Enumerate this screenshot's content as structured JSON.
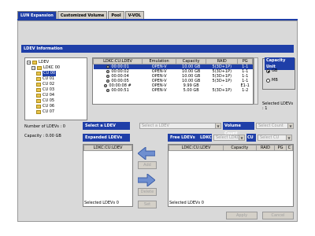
{
  "tabs": [
    "LUN Expansion",
    "Customized Volume",
    "Pool",
    "V-VOL"
  ],
  "ldev_info": {
    "title": "LDEV Information"
  },
  "tree": [
    {
      "label": "LDEV",
      "level": 0
    },
    {
      "label": "LDKC 00",
      "level": 1
    },
    {
      "label": "CU 00",
      "level": 2,
      "selected": true
    },
    {
      "label": "CU 01",
      "level": 2
    },
    {
      "label": "CU 02",
      "level": 2
    },
    {
      "label": "CU 03",
      "level": 2
    },
    {
      "label": "CU 04",
      "level": 2
    },
    {
      "label": "CU 05",
      "level": 2
    },
    {
      "label": "CU 06",
      "level": 2
    },
    {
      "label": "CU 07",
      "level": 2
    }
  ],
  "ldev_table": {
    "headers": [
      "LDKC:CU:LDEV",
      "Emulation",
      "Capacity",
      "RAID",
      "PG"
    ],
    "rows": [
      [
        "00:00:01",
        "OPEN-V",
        "10.00 GB",
        "5(3D+1P)",
        "1-1"
      ],
      [
        "00:00:02",
        "OPEN-V",
        "10.00 GB",
        "5(3D+1P)",
        "1-1"
      ],
      [
        "00:00:04",
        "OPEN-V",
        "10.00 GB",
        "5(3D+1P)",
        "1-1"
      ],
      [
        "00:00:05",
        "OPEN-V",
        "10.00 GB",
        "5(3D+1P)",
        "1-1"
      ],
      [
        "00:00:08 #",
        "OPEN-V",
        "9.99 GB",
        "-",
        "E1-1"
      ],
      [
        "00:00:51",
        "OPEN-V",
        "5.00 GB",
        "5(3D+1P)",
        "1-2"
      ]
    ]
  },
  "capacity_unit": {
    "title": "Capacity Unit",
    "options": [
      "GB",
      "MB"
    ],
    "selected_label": "Selected LDEVs :",
    "selected_value": "1"
  },
  "stats": {
    "num_label": "Number of LDEVs :",
    "num_value": "0",
    "cap_label": "Capacity :",
    "cap_value": "0.00 GB"
  },
  "select_ldev": {
    "label": "Select a LDEV",
    "placeholder": "Select a LDEV"
  },
  "volume_count": {
    "label": "Volume Count",
    "placeholder": "Select Count"
  },
  "expanded": {
    "title": "Expanded LDEVs",
    "header": "LDKC:CU:LDEV",
    "footer_label": "Selected LDEVs",
    "footer_value": "0"
  },
  "free": {
    "title": "Free LDEVs",
    "ldkc_label": "LDKC",
    "ldkc_placeholder": "Select LDKC",
    "cu_label": "CU",
    "cu_placeholder": "Select CU",
    "headers": [
      "LDKC:CU:LDEV",
      "Capacity",
      "RAID",
      "PG",
      "C"
    ],
    "footer_label": "Selected LDEVs",
    "footer_value": "0"
  },
  "buttons": {
    "add": "Add",
    "delete": "Delete",
    "set": "Set",
    "apply": "Apply",
    "cancel": "Cancel"
  }
}
